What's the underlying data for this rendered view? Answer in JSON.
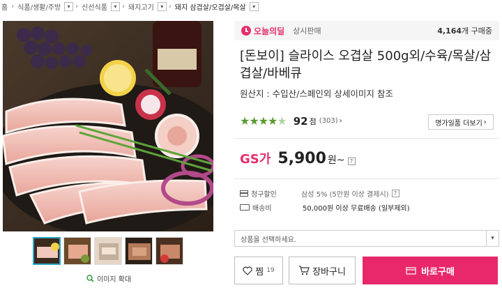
{
  "breadcrumb": {
    "items": [
      {
        "label": "홈"
      },
      {
        "label": "식품/생활/주방"
      },
      {
        "label": "신선식품"
      },
      {
        "label": "돼지고기"
      },
      {
        "label": "돼지 삼겹살/오겹살/목살"
      }
    ]
  },
  "deal": {
    "logo_text": "오늘의딜",
    "type": "상시판매",
    "count": "4,164",
    "count_suffix": "개 구매중"
  },
  "product": {
    "title": "[돈보이] 슬라이스 오겹살 500g외/수육/목살/삼겹살/바베큐",
    "origin": "원산지 : 수입산/스페인외 상세이미지 참조",
    "rating_stars": 4.5,
    "score": "92",
    "score_unit": "점",
    "review_count": "(303)",
    "reviews_button": "명가일품 더보기",
    "price_label": "GS가",
    "price": "5,900",
    "price_unit": "원~"
  },
  "info": {
    "discount_label": "청구할인",
    "discount_value": "삼성 5% (5만원 이상 결제시)",
    "shipping_label": "배송비",
    "shipping_value": "50,000원 이상 무료배송 (일부제외)"
  },
  "options": {
    "placeholder": "상품을 선택하세요."
  },
  "gallery": {
    "zoom_label": "이미지 확대",
    "thumbnail_count": 5,
    "selected_thumbnail": 1
  },
  "actions": {
    "wish_label": "찜",
    "wish_count": "19",
    "cart_label": "장바구니",
    "buy_label": "바로구매"
  },
  "colors": {
    "accent": "#e8286a",
    "star": "#5a9a30",
    "thumb_selected": "#2aa6c4"
  }
}
